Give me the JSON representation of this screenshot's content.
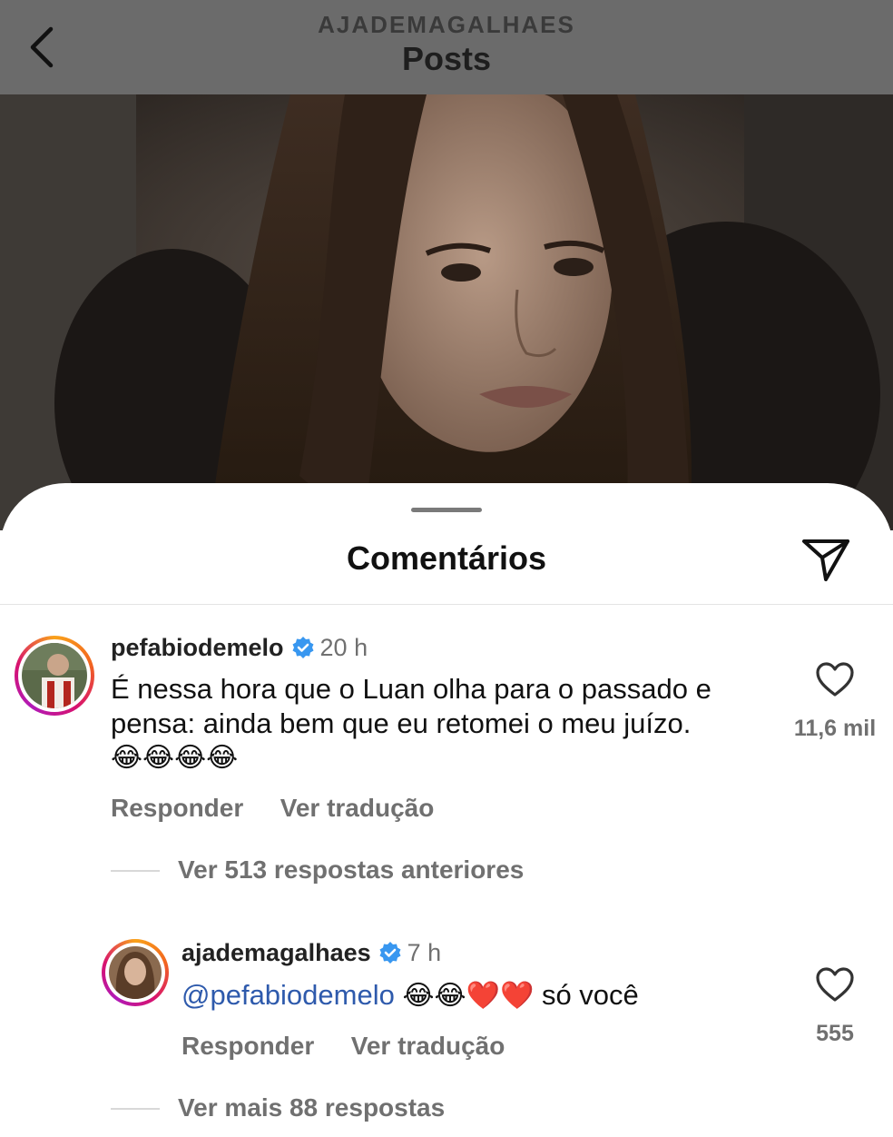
{
  "header": {
    "account": "AJADEMAGALHAES",
    "title": "Posts"
  },
  "sheet": {
    "title": "Comentários"
  },
  "comments": [
    {
      "username": "pefabiodemelo",
      "time": "20 h",
      "text_line1": "É nessa hora que o Luan olha para o passado e",
      "text_line2": "pensa: ainda bem que eu retomei o meu juízo.",
      "emojis": "😂😂😂😂",
      "likes": "11,6 mil",
      "reply_label": "Responder",
      "translate_label": "Ver tradução",
      "view_replies": "Ver 513 respostas anteriores"
    },
    {
      "username": "ajademagalhaes",
      "time": "7 h",
      "mention": "@pefabiodemelo",
      "emojis": "😂😂❤️❤️",
      "text": "só você",
      "likes": "555",
      "reply_label": "Responder",
      "translate_label": "Ver tradução",
      "view_more": "Ver mais 88 respostas"
    }
  ],
  "icons": {
    "back": "chevron-left-icon",
    "share": "paper-plane-icon",
    "like": "heart-outline-icon",
    "verified": "verified-badge-icon"
  },
  "colors": {
    "verified": "#3897f0",
    "mention": "#2e5aac",
    "header_dim": "#6b6b6b"
  }
}
